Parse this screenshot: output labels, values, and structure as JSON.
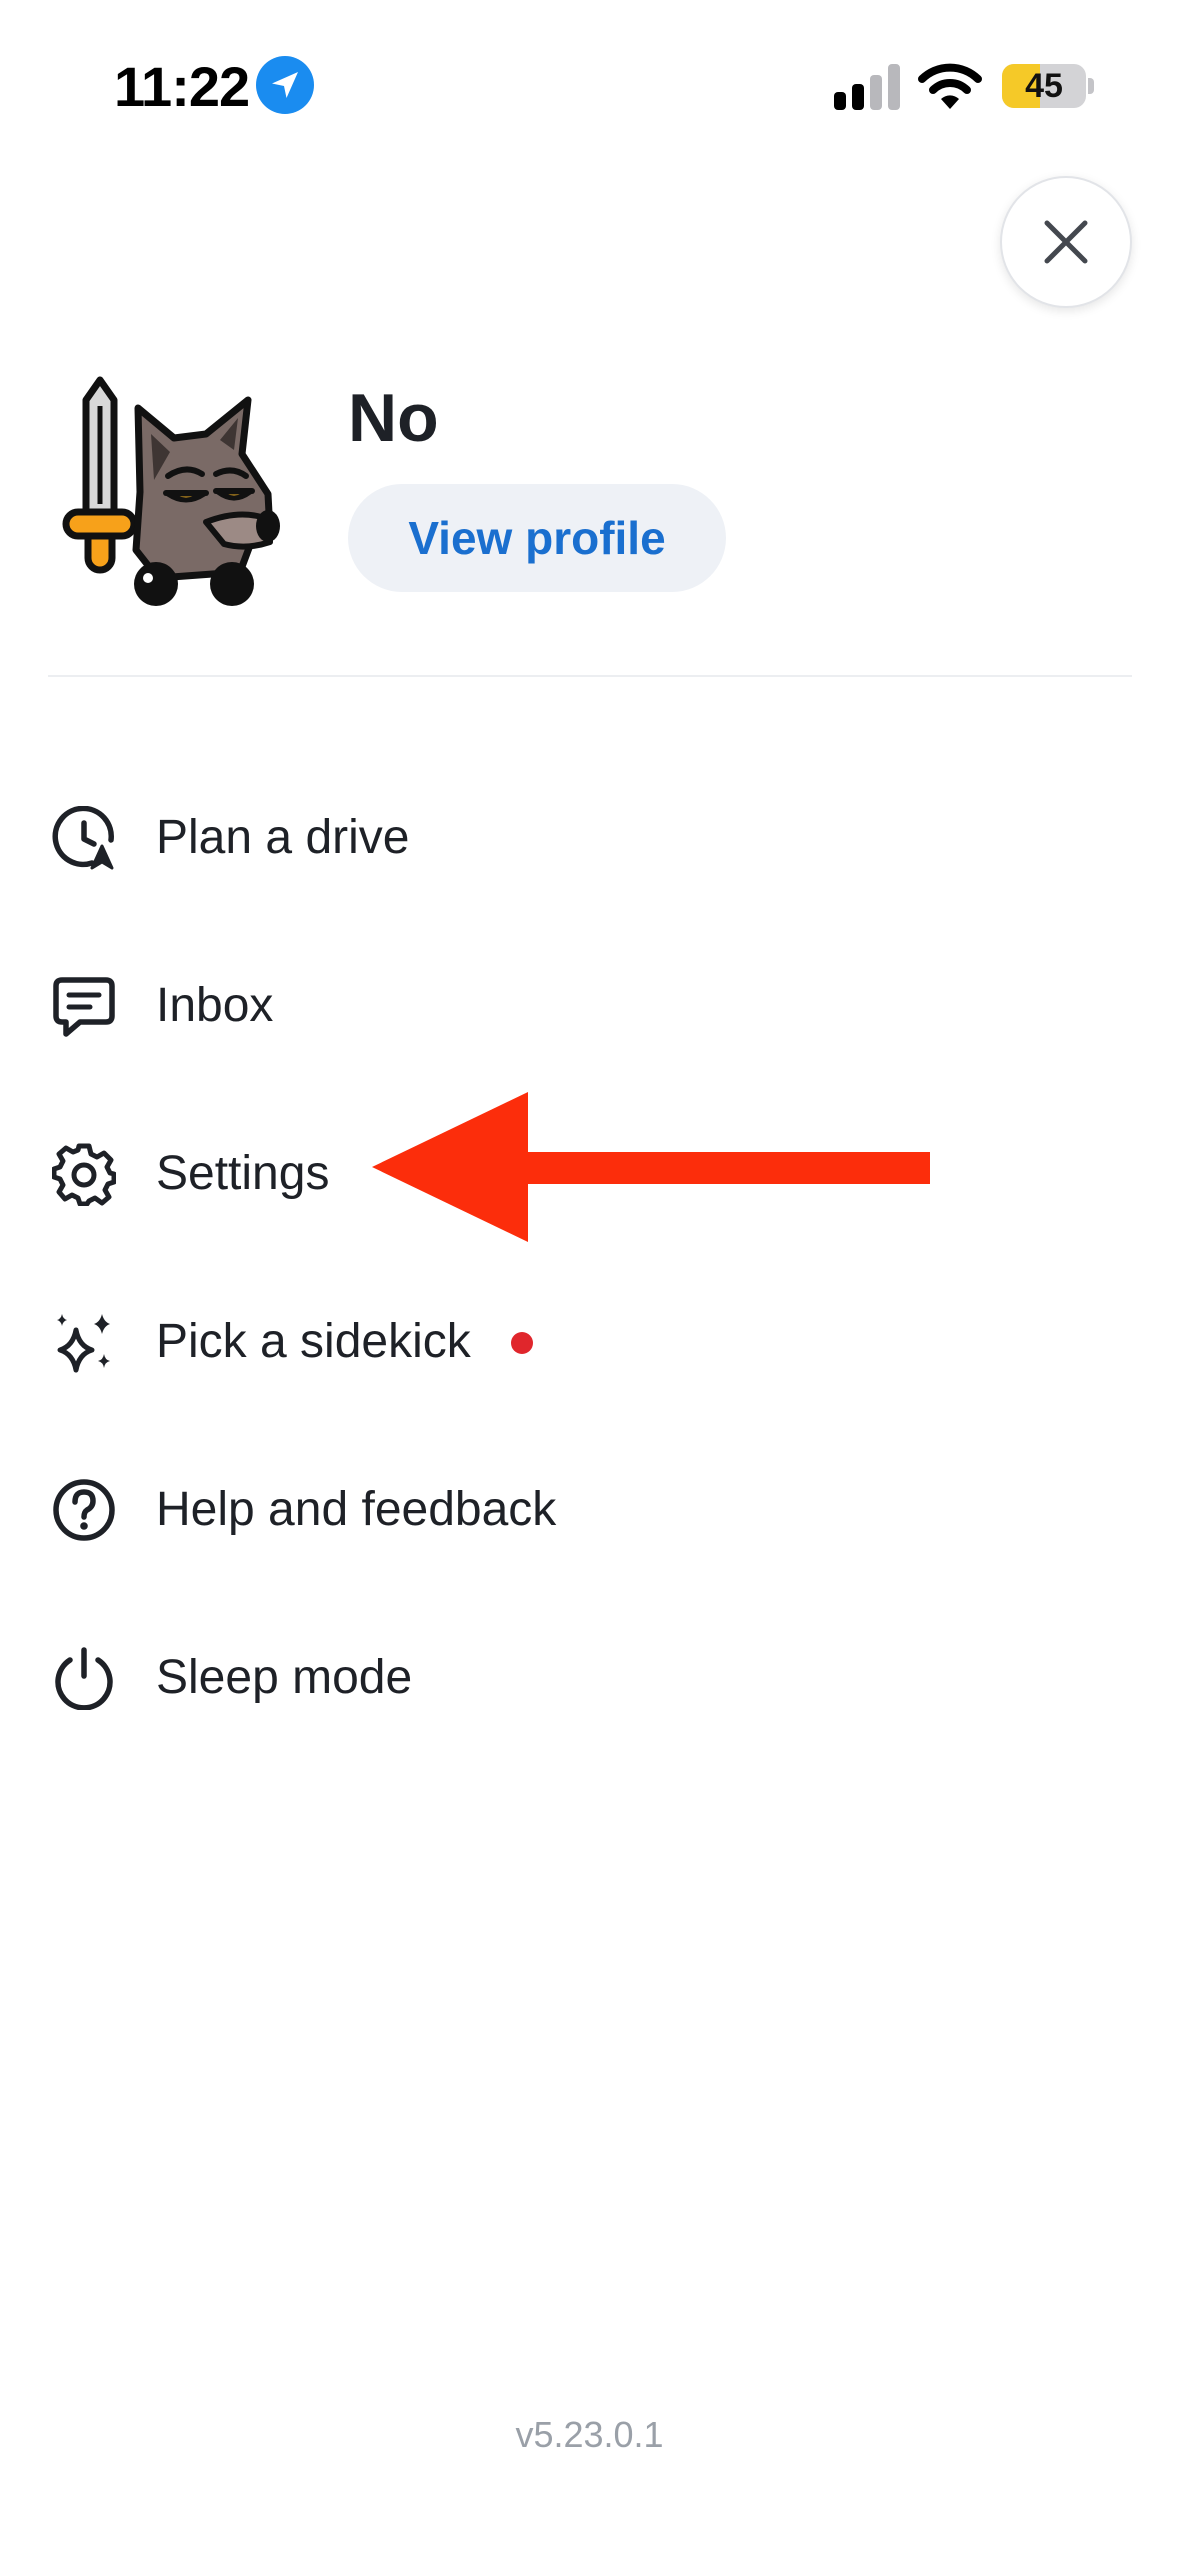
{
  "status_bar": {
    "time": "11:22",
    "battery_level": "45",
    "battery_fraction": 0.45,
    "icons": [
      "location-arrow-icon",
      "signal-icon",
      "wifi-icon",
      "battery-icon"
    ]
  },
  "header": {
    "close_icon": "close-icon"
  },
  "profile": {
    "name": "No",
    "view_profile_label": "View profile",
    "avatar": "wolf-knight-avatar"
  },
  "menu": {
    "items": [
      {
        "label": "Plan a drive",
        "icon": "clock-navigation-icon"
      },
      {
        "label": "Inbox",
        "icon": "message-icon"
      },
      {
        "label": "Settings",
        "icon": "gear-icon"
      },
      {
        "label": "Pick a sidekick",
        "icon": "sparkles-icon",
        "badge_dot": true
      },
      {
        "label": "Help and feedback",
        "icon": "question-circle-icon"
      },
      {
        "label": "Sleep mode",
        "icon": "power-icon"
      }
    ]
  },
  "annotation": {
    "arrow_points_to": "Settings",
    "color": "#fc2d0b"
  },
  "footer": {
    "version": "v5.23.0.1"
  },
  "colors": {
    "accent_blue": "#1a6fcf",
    "button_bg": "#eef1f6",
    "badge_red": "#e0262c",
    "battery_yellow": "#f5c928",
    "text_primary": "#1e2127",
    "text_muted": "#9aa0a8"
  }
}
